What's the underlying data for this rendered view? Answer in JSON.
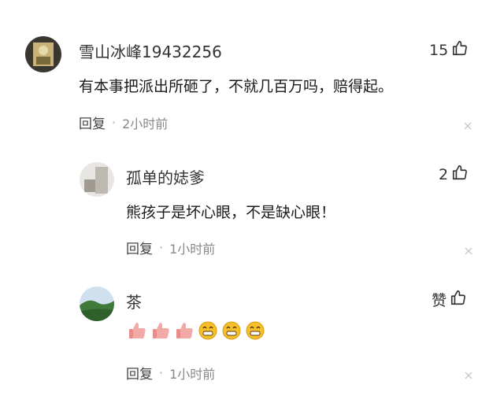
{
  "comments": [
    {
      "user": "雪山冰峰19432256",
      "text": "有本事把派出所砸了，不就几百万吗，赔得起。",
      "reply_label": "回复",
      "separator": "·",
      "time": "2小时前",
      "likes": "15"
    },
    {
      "user": "孤单的娡爹",
      "text": "熊孩子是坏心眼，不是缺心眼！",
      "reply_label": "回复",
      "separator": "·",
      "time": "1小时前",
      "likes": "2"
    },
    {
      "user": "茶",
      "reply_label": "回复",
      "separator": "·",
      "time": "1小时前",
      "likes": "赞",
      "emojis": [
        "thumbs-up-icon",
        "thumbs-up-icon",
        "thumbs-up-icon",
        "grin-face-icon",
        "grin-face-icon",
        "grin-face-icon"
      ]
    }
  ],
  "colors": {
    "text": "#1a1a1a",
    "meta": "#888888",
    "emoji_yellow": "#f6c02a",
    "thumb_skin": "#f3a9a6"
  }
}
